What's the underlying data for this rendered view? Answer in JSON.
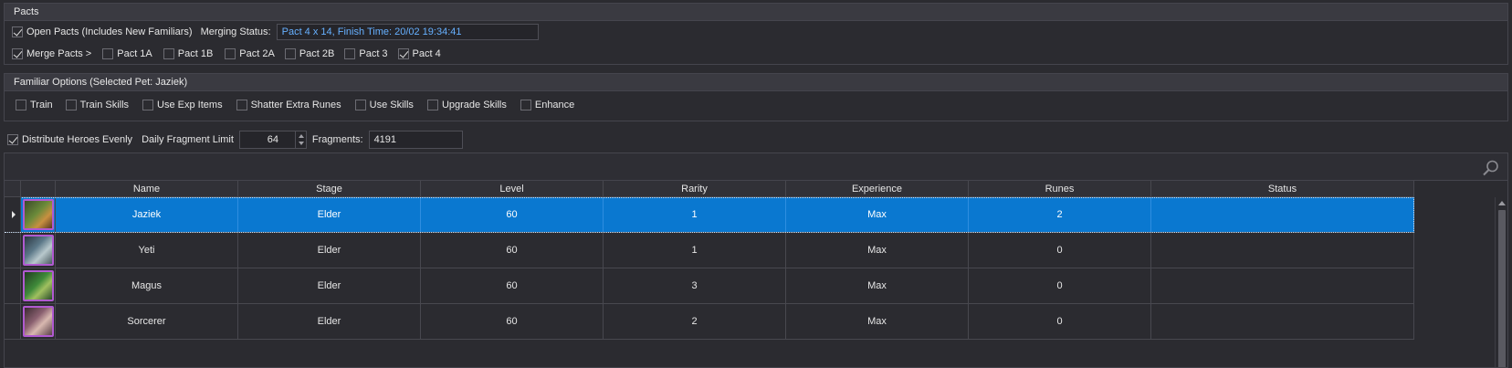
{
  "pacts": {
    "header": "Pacts",
    "open_pacts_label": "Open Pacts (Includes New Familiars)",
    "merging_status_label": "Merging Status:",
    "merging_status_value": "Pact 4 x 14, Finish Time: 20/02 19:34:41",
    "merge_pacts_label": "Merge Pacts >",
    "pact_options": [
      {
        "label": "Pact 1A",
        "checked": false
      },
      {
        "label": "Pact 1B",
        "checked": false
      },
      {
        "label": "Pact 2A",
        "checked": false
      },
      {
        "label": "Pact 2B",
        "checked": false
      },
      {
        "label": "Pact 3",
        "checked": false
      },
      {
        "label": "Pact 4",
        "checked": true
      }
    ]
  },
  "familiar_options": {
    "header": "Familiar Options (Selected Pet: Jaziek)",
    "options": [
      {
        "label": "Train",
        "checked": false
      },
      {
        "label": "Train Skills",
        "checked": false
      },
      {
        "label": "Use Exp Items",
        "checked": false
      },
      {
        "label": "Shatter Extra Runes",
        "checked": false
      },
      {
        "label": "Use Skills",
        "checked": false
      },
      {
        "label": "Upgrade Skills",
        "checked": false
      },
      {
        "label": "Enhance",
        "checked": false
      }
    ]
  },
  "fragments": {
    "distribute_label": "Distribute Heroes Evenly",
    "daily_limit_label": "Daily Fragment Limit",
    "daily_limit_value": "64",
    "fragments_label": "Fragments:",
    "fragments_value": "4191"
  },
  "grid": {
    "columns": [
      "Name",
      "Stage",
      "Level",
      "Rarity",
      "Experience",
      "Runes",
      "Status"
    ],
    "rows": [
      {
        "name": "Jaziek",
        "stage": "Elder",
        "level": "60",
        "rarity": "1",
        "experience": "Max",
        "runes": "2",
        "status": "",
        "selected": true
      },
      {
        "name": "Yeti",
        "stage": "Elder",
        "level": "60",
        "rarity": "1",
        "experience": "Max",
        "runes": "0",
        "status": "",
        "selected": false
      },
      {
        "name": "Magus",
        "stage": "Elder",
        "level": "60",
        "rarity": "3",
        "experience": "Max",
        "runes": "0",
        "status": "",
        "selected": false
      },
      {
        "name": "Sorcerer",
        "stage": "Elder",
        "level": "60",
        "rarity": "2",
        "experience": "Max",
        "runes": "0",
        "status": "",
        "selected": false
      }
    ]
  },
  "colors": {
    "selection": "#0a78d0",
    "status_text": "#66b0ff",
    "pet_frame": "#b05ad0"
  }
}
